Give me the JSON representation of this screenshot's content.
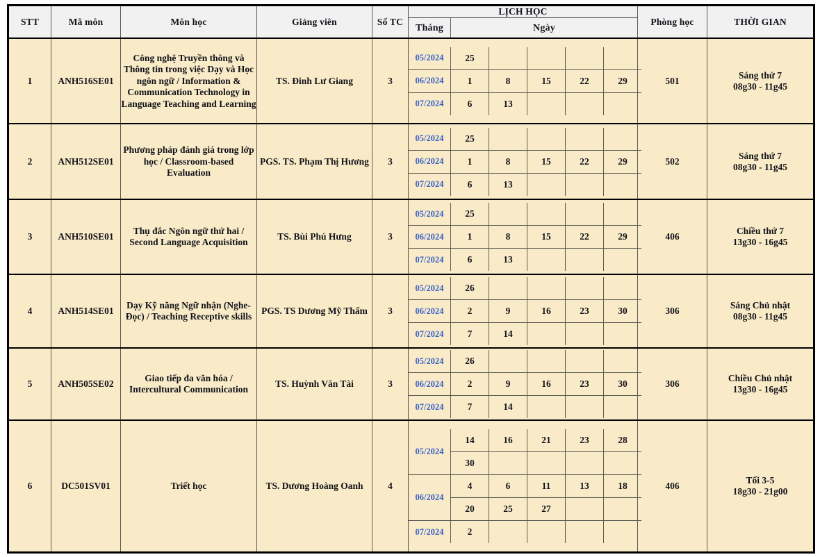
{
  "table": {
    "headers": {
      "stt": "STT",
      "ma_mon": "Mã môn",
      "mon_hoc": "Môn học",
      "giang_vien": "Giảng viên",
      "so_tc": "Số TC",
      "lich_hoc": "LỊCH HỌC",
      "thang": "Tháng",
      "ngay": "Ngày",
      "phong_hoc": "Phòng học",
      "thoi_gian": "THỜI GIAN"
    },
    "colors": {
      "header_bg": "#F1F1F1",
      "row_bg": "#FAEBC8",
      "month_text": "#3761c8",
      "accent_text": "#D00000",
      "border": "#5a5a52",
      "outer_border": "#000000"
    },
    "rows": [
      {
        "stt": "1",
        "ma_mon": "ANH516SE01",
        "mon_hoc": "Công nghệ Truyền thông và Thông tin trong việc Dạy và Học ngôn ngữ / Information & Communication Technology in Language Teaching and Learning",
        "giang_vien": "TS. Đinh Lư Giang",
        "so_tc": "3",
        "schedule": [
          {
            "thang": "05/2024",
            "rowspan": 1,
            "days": [
              [
                "25",
                "",
                "",
                "",
                ""
              ]
            ]
          },
          {
            "thang": "06/2024",
            "rowspan": 1,
            "days": [
              [
                "1",
                "8",
                "15",
                "22",
                "29"
              ]
            ]
          },
          {
            "thang": "07/2024",
            "rowspan": 1,
            "days": [
              [
                "6",
                "13",
                "",
                "",
                ""
              ]
            ]
          }
        ],
        "phong_hoc": "501",
        "thoi_gian_line1": "Sáng thứ 7",
        "thoi_gian_line2": "08g30 - 11g45"
      },
      {
        "stt": "2",
        "ma_mon": "ANH512SE01",
        "mon_hoc": "Phương pháp đánh giá trong lớp học / Classroom-based Evaluation",
        "giang_vien": "PGS. TS. Phạm Thị Hương",
        "so_tc": "3",
        "schedule": [
          {
            "thang": "05/2024",
            "rowspan": 1,
            "days": [
              [
                "25",
                "",
                "",
                "",
                ""
              ]
            ]
          },
          {
            "thang": "06/2024",
            "rowspan": 1,
            "days": [
              [
                "1",
                "8",
                "15",
                "22",
                "29"
              ]
            ]
          },
          {
            "thang": "07/2024",
            "rowspan": 1,
            "days": [
              [
                "6",
                "13",
                "",
                "",
                ""
              ]
            ]
          }
        ],
        "phong_hoc": "502",
        "thoi_gian_line1": "Sáng thứ 7",
        "thoi_gian_line2": "08g30 - 11g45"
      },
      {
        "stt": "3",
        "ma_mon": "ANH510SE01",
        "mon_hoc": "Thụ đắc Ngôn ngữ thứ hai / Second Language Acquisition",
        "giang_vien": "TS. Bùi Phú Hưng",
        "so_tc": "3",
        "schedule": [
          {
            "thang": "05/2024",
            "rowspan": 1,
            "days": [
              [
                "25",
                "",
                "",
                "",
                ""
              ]
            ]
          },
          {
            "thang": "06/2024",
            "rowspan": 1,
            "days": [
              [
                "1",
                "8",
                "15",
                "22",
                "29"
              ]
            ]
          },
          {
            "thang": "07/2024",
            "rowspan": 1,
            "days": [
              [
                "6",
                "13",
                "",
                "",
                ""
              ]
            ]
          }
        ],
        "phong_hoc": "406",
        "thoi_gian_line1": "Chiều thứ 7",
        "thoi_gian_line2": "13g30 - 16g45"
      },
      {
        "stt": "4",
        "ma_mon": "ANH514SE01",
        "mon_hoc": "Dạy Kỹ năng Ngữ nhận (Nghe-Đọc) / Teaching Receptive skills",
        "giang_vien": "PGS. TS Dương Mỹ Thẩm",
        "so_tc": "3",
        "schedule": [
          {
            "thang": "05/2024",
            "rowspan": 1,
            "days": [
              [
                "26",
                "",
                "",
                "",
                ""
              ]
            ]
          },
          {
            "thang": "06/2024",
            "rowspan": 1,
            "days": [
              [
                "2",
                "9",
                "16",
                "23",
                "30"
              ]
            ]
          },
          {
            "thang": "07/2024",
            "rowspan": 1,
            "days": [
              [
                "7",
                "14",
                "",
                "",
                ""
              ]
            ]
          }
        ],
        "phong_hoc": "306",
        "thoi_gian_line1": "Sáng Chủ nhật",
        "thoi_gian_line2": "08g30 - 11g45"
      },
      {
        "stt": "5",
        "ma_mon": "ANH505SE02",
        "mon_hoc": "Giao tiếp đa văn hóa / Intercultural Communication",
        "giang_vien": "TS. Huỳnh Văn Tài",
        "so_tc": "3",
        "schedule": [
          {
            "thang": "05/2024",
            "rowspan": 1,
            "days": [
              [
                "26",
                "",
                "",
                "",
                ""
              ]
            ]
          },
          {
            "thang": "06/2024",
            "rowspan": 1,
            "days": [
              [
                "2",
                "9",
                "16",
                "23",
                "30"
              ]
            ]
          },
          {
            "thang": "07/2024",
            "rowspan": 1,
            "days": [
              [
                "7",
                "14",
                "",
                "",
                ""
              ]
            ]
          }
        ],
        "phong_hoc": "306",
        "thoi_gian_line1": "Chiều Chủ nhật",
        "thoi_gian_line2": "13g30 - 16g45"
      },
      {
        "stt": "6",
        "ma_mon": "DC501SV01",
        "mon_hoc": "Triết học",
        "giang_vien": "TS. Dương Hoàng Oanh",
        "so_tc": "4",
        "schedule": [
          {
            "thang": "05/2024",
            "rowspan": 2,
            "days": [
              [
                "14",
                "16",
                "21",
                "23",
                "28"
              ],
              [
                "30",
                "",
                "",
                "",
                ""
              ]
            ]
          },
          {
            "thang": "06/2024",
            "rowspan": 2,
            "days": [
              [
                "4",
                "6",
                "11",
                "13",
                "18"
              ],
              [
                "20",
                "25",
                "27",
                "",
                ""
              ]
            ]
          },
          {
            "thang": "07/2024",
            "rowspan": 1,
            "days": [
              [
                "2",
                "",
                "",
                "",
                ""
              ]
            ]
          }
        ],
        "phong_hoc": "406",
        "thoi_gian_line1": "Tối 3-5",
        "thoi_gian_line2": "18g30 - 21g00"
      }
    ]
  }
}
